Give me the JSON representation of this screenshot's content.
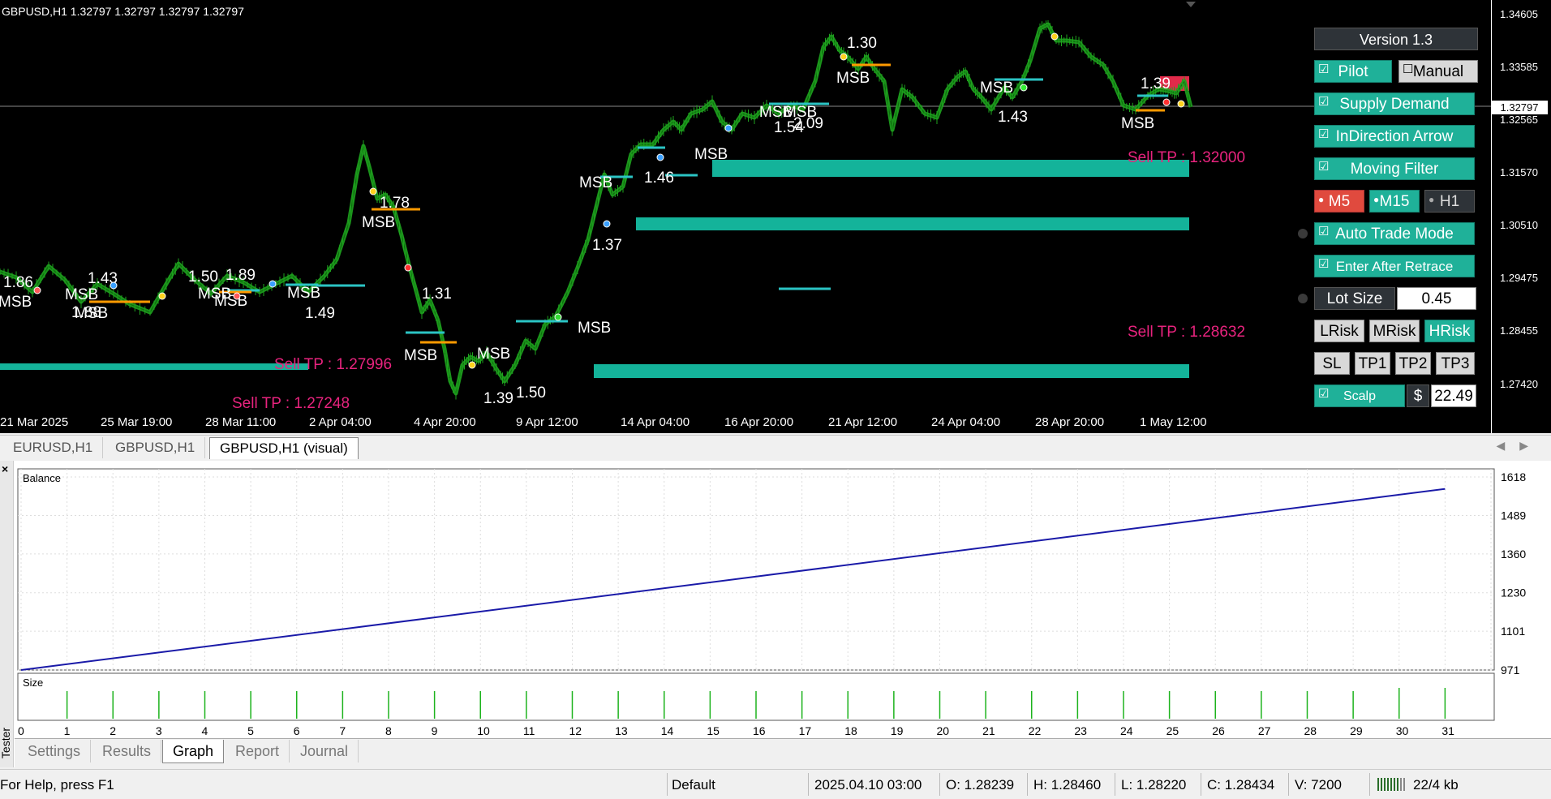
{
  "chart": {
    "header": "GBPUSD,H1  1.32797 1.32797 1.32797 1.32797",
    "price_ticks": [
      "1.34605",
      "1.33585",
      "1.32565",
      "1.31570",
      "1.30510",
      "1.29475",
      "1.28455",
      "1.27420"
    ],
    "current_price": "1.32797",
    "time_ticks": [
      "21 Mar 2025",
      "25 Mar 19:00",
      "28 Mar 11:00",
      "2 Apr 04:00",
      "4 Apr 20:00",
      "9 Apr 12:00",
      "14 Apr 04:00",
      "16 Apr 20:00",
      "21 Apr 12:00",
      "24 Apr 04:00",
      "28 Apr 20:00",
      "1 May 12:00"
    ],
    "annotations": [
      {
        "text": "1.86",
        "kind": "ratio"
      },
      {
        "text": "MSB",
        "kind": "msb"
      },
      {
        "text": "1.43",
        "kind": "ratio"
      },
      {
        "text": "MSB",
        "kind": "msb"
      },
      {
        "text": "1.88",
        "kind": "ratio"
      },
      {
        "text": "MSB",
        "kind": "msb"
      },
      {
        "text": "1.50",
        "kind": "ratio"
      },
      {
        "text": "1.89",
        "kind": "ratio"
      },
      {
        "text": "MSB",
        "kind": "msb"
      },
      {
        "text": "MSB",
        "kind": "msb"
      },
      {
        "text": "MSB",
        "kind": "msb"
      },
      {
        "text": "1.49",
        "kind": "ratio"
      },
      {
        "text": "1.78",
        "kind": "ratio"
      },
      {
        "text": "MSB",
        "kind": "msb"
      },
      {
        "text": "1.31",
        "kind": "ratio"
      },
      {
        "text": "MSB",
        "kind": "msb"
      },
      {
        "text": "MSB",
        "kind": "msb"
      },
      {
        "text": "1.39",
        "kind": "ratio"
      },
      {
        "text": "1.50",
        "kind": "ratio"
      },
      {
        "text": "MSB",
        "kind": "msb"
      },
      {
        "text": "1.37",
        "kind": "ratio"
      },
      {
        "text": "MSB",
        "kind": "msb"
      },
      {
        "text": "1.46",
        "kind": "ratio"
      },
      {
        "text": "MSB",
        "kind": "msb"
      },
      {
        "text": "MSB",
        "kind": "msb"
      },
      {
        "text": "MSB",
        "kind": "msb"
      },
      {
        "text": "1.54",
        "kind": "ratio"
      },
      {
        "text": "2.09",
        "kind": "ratio"
      },
      {
        "text": "1.30",
        "kind": "ratio"
      },
      {
        "text": "MSB",
        "kind": "msb"
      },
      {
        "text": "MSB",
        "kind": "msb"
      },
      {
        "text": "1.43",
        "kind": "ratio"
      },
      {
        "text": "1.39",
        "kind": "ratio"
      },
      {
        "text": "MSB",
        "kind": "msb"
      }
    ],
    "tp_labels": [
      "Sell TP : 1.27996",
      "Sell TP : 1.27248",
      "Sell TP : 1.32000",
      "Sell TP : 1.28632"
    ],
    "colors": {
      "candles": "#1ea31e",
      "zone": "#14b39a",
      "msb_line": "#2bc4c4",
      "level_line": "#ff9a00",
      "tp_text": "#e8237e"
    }
  },
  "panel": {
    "version": "Version 1.3",
    "pilot": "Pilot",
    "manual": "Manual",
    "supply_demand": "Supply Demand",
    "indirection_arrow": "InDirection Arrow",
    "moving_filter": "Moving Filter",
    "tf_m5": "M5",
    "tf_m15": "M15",
    "tf_h1": "H1",
    "auto_trade": "Auto Trade Mode",
    "enter_after_retrace": "Enter After Retrace",
    "lot_size_label": "Lot Size",
    "lot_size_value": "0.45",
    "lrisk": "LRisk",
    "mrisk": "MRisk",
    "hrisk": "HRisk",
    "sl": "SL",
    "tp1": "TP1",
    "tp2": "TP2",
    "tp3": "TP3",
    "scalp": "Scalp",
    "currency": "$",
    "scalp_value": "22.49",
    "check": "☑"
  },
  "chart_tabs": [
    "EURUSD,H1",
    "GBPUSD,H1",
    "GBPUSD,H1 (visual)"
  ],
  "tester": {
    "side_label": "Tester",
    "close": "×",
    "balance_label": "Balance",
    "size_label": "Size",
    "balance_ticks": [
      "1618",
      "1489",
      "1360",
      "1230",
      "1101",
      "971"
    ],
    "x_ticks": [
      "0",
      "1",
      "2",
      "3",
      "4",
      "5",
      "6",
      "7",
      "8",
      "9",
      "10",
      "11",
      "12",
      "13",
      "14",
      "15",
      "16",
      "17",
      "18",
      "19",
      "20",
      "21",
      "22",
      "23",
      "24",
      "25",
      "26",
      "27",
      "28",
      "29",
      "30",
      "31"
    ],
    "tabs": [
      "Settings",
      "Results",
      "Graph",
      "Report",
      "Journal"
    ],
    "active_tab": "Graph"
  },
  "chart_data": {
    "type": "line",
    "title": "",
    "xlabel": "",
    "ylabel": "",
    "series": [
      {
        "name": "Balance",
        "x": [
          0,
          31
        ],
        "values": [
          971,
          1578
        ]
      }
    ],
    "size_bars": {
      "x": [
        1,
        2,
        3,
        4,
        5,
        6,
        7,
        8,
        9,
        10,
        11,
        12,
        13,
        14,
        15,
        16,
        17,
        18,
        19,
        20,
        21,
        22,
        23,
        24,
        25,
        26,
        27,
        28,
        29,
        30,
        31
      ],
      "values": [
        1,
        1,
        1,
        1,
        1,
        1,
        1,
        1,
        1,
        1,
        1,
        1,
        1,
        1,
        1,
        1,
        1,
        1,
        1,
        1,
        1,
        1,
        1,
        1,
        1,
        1,
        1,
        1,
        1,
        1,
        1
      ]
    },
    "ylim": [
      971,
      1618
    ],
    "xlim": [
      0,
      32
    ],
    "grid": true
  },
  "statusbar": {
    "help": "For Help, press F1",
    "profile": "Default",
    "datetime": "2025.04.10 03:00",
    "open": "O: 1.28239",
    "high": "H: 1.28460",
    "low": "L: 1.28220",
    "close": "C: 1.28434",
    "volume": "V: 7200",
    "traffic": "22/4 kb"
  }
}
